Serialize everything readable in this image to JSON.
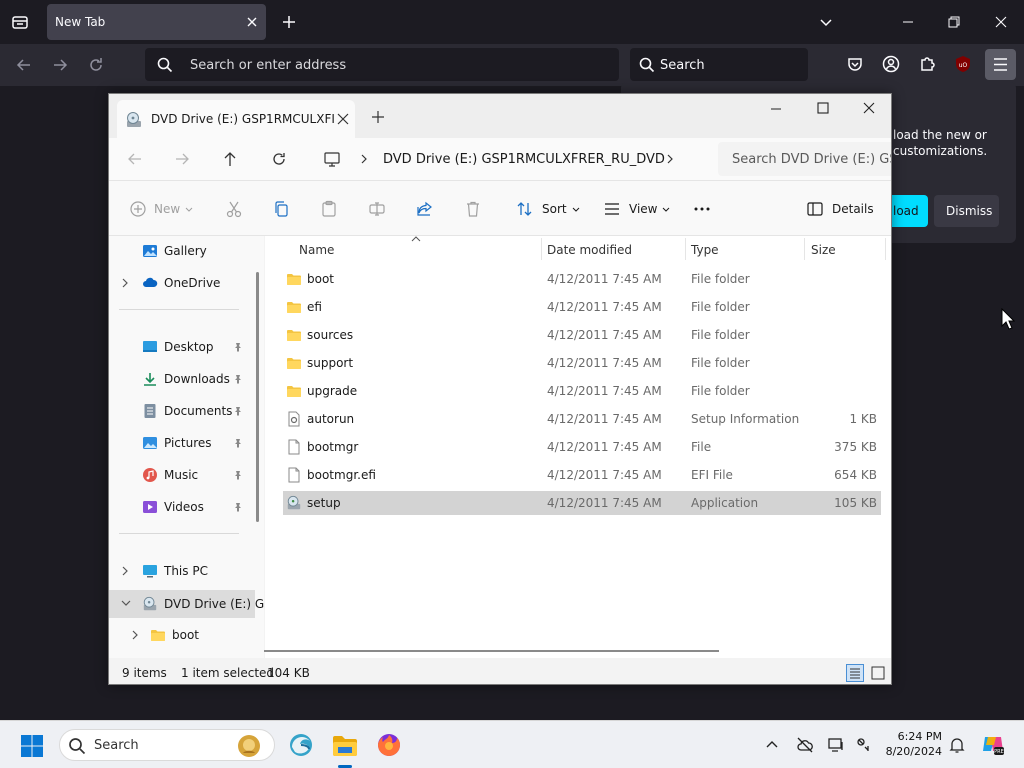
{
  "browser": {
    "tab_title": "New Tab",
    "url_placeholder": "Search or enter address",
    "search_placeholder": "Search",
    "notice": {
      "text": "load the new or customizations.",
      "primary_label": "load",
      "secondary_label": "Dismiss",
      "primary_color": "#00ddff"
    }
  },
  "explorer": {
    "tab_title": "DVD Drive (E:) GSP1RMCULXFI",
    "breadcrumb": "DVD Drive (E:) GSP1RMCULXFRER_RU_DVD",
    "search_placeholder": "Search DVD Drive (E:) GSP",
    "commands": {
      "new": "New",
      "sort": "Sort",
      "view": "View",
      "details": "Details"
    },
    "nav": {
      "gallery": "Gallery",
      "onedrive": "OneDrive",
      "desktop": "Desktop",
      "downloads": "Downloads",
      "documents": "Documents",
      "pictures": "Pictures",
      "music": "Music",
      "videos": "Videos",
      "thispc": "This PC",
      "dvd": "DVD Drive (E:) G",
      "boot": "boot"
    },
    "columns": {
      "name": "Name",
      "date": "Date modified",
      "type": "Type",
      "size": "Size"
    },
    "files": [
      {
        "name": "boot",
        "date": "4/12/2011 7:45 AM",
        "type": "File folder",
        "size": ""
      },
      {
        "name": "efi",
        "date": "4/12/2011 7:45 AM",
        "type": "File folder",
        "size": ""
      },
      {
        "name": "sources",
        "date": "4/12/2011 7:45 AM",
        "type": "File folder",
        "size": ""
      },
      {
        "name": "support",
        "date": "4/12/2011 7:45 AM",
        "type": "File folder",
        "size": ""
      },
      {
        "name": "upgrade",
        "date": "4/12/2011 7:45 AM",
        "type": "File folder",
        "size": ""
      },
      {
        "name": "autorun",
        "date": "4/12/2011 7:45 AM",
        "type": "Setup Information",
        "size": "1 KB"
      },
      {
        "name": "bootmgr",
        "date": "4/12/2011 7:45 AM",
        "type": "File",
        "size": "375 KB"
      },
      {
        "name": "bootmgr.efi",
        "date": "4/12/2011 7:45 AM",
        "type": "EFI File",
        "size": "654 KB"
      },
      {
        "name": "setup",
        "date": "4/12/2011 7:45 AM",
        "type": "Application",
        "size": "105 KB"
      }
    ],
    "status": {
      "count": "9 items",
      "selected": "1 item selected",
      "selected_size": "104 KB"
    }
  },
  "taskbar": {
    "search_placeholder": "Search",
    "time": "6:24 PM",
    "date": "8/20/2024"
  }
}
